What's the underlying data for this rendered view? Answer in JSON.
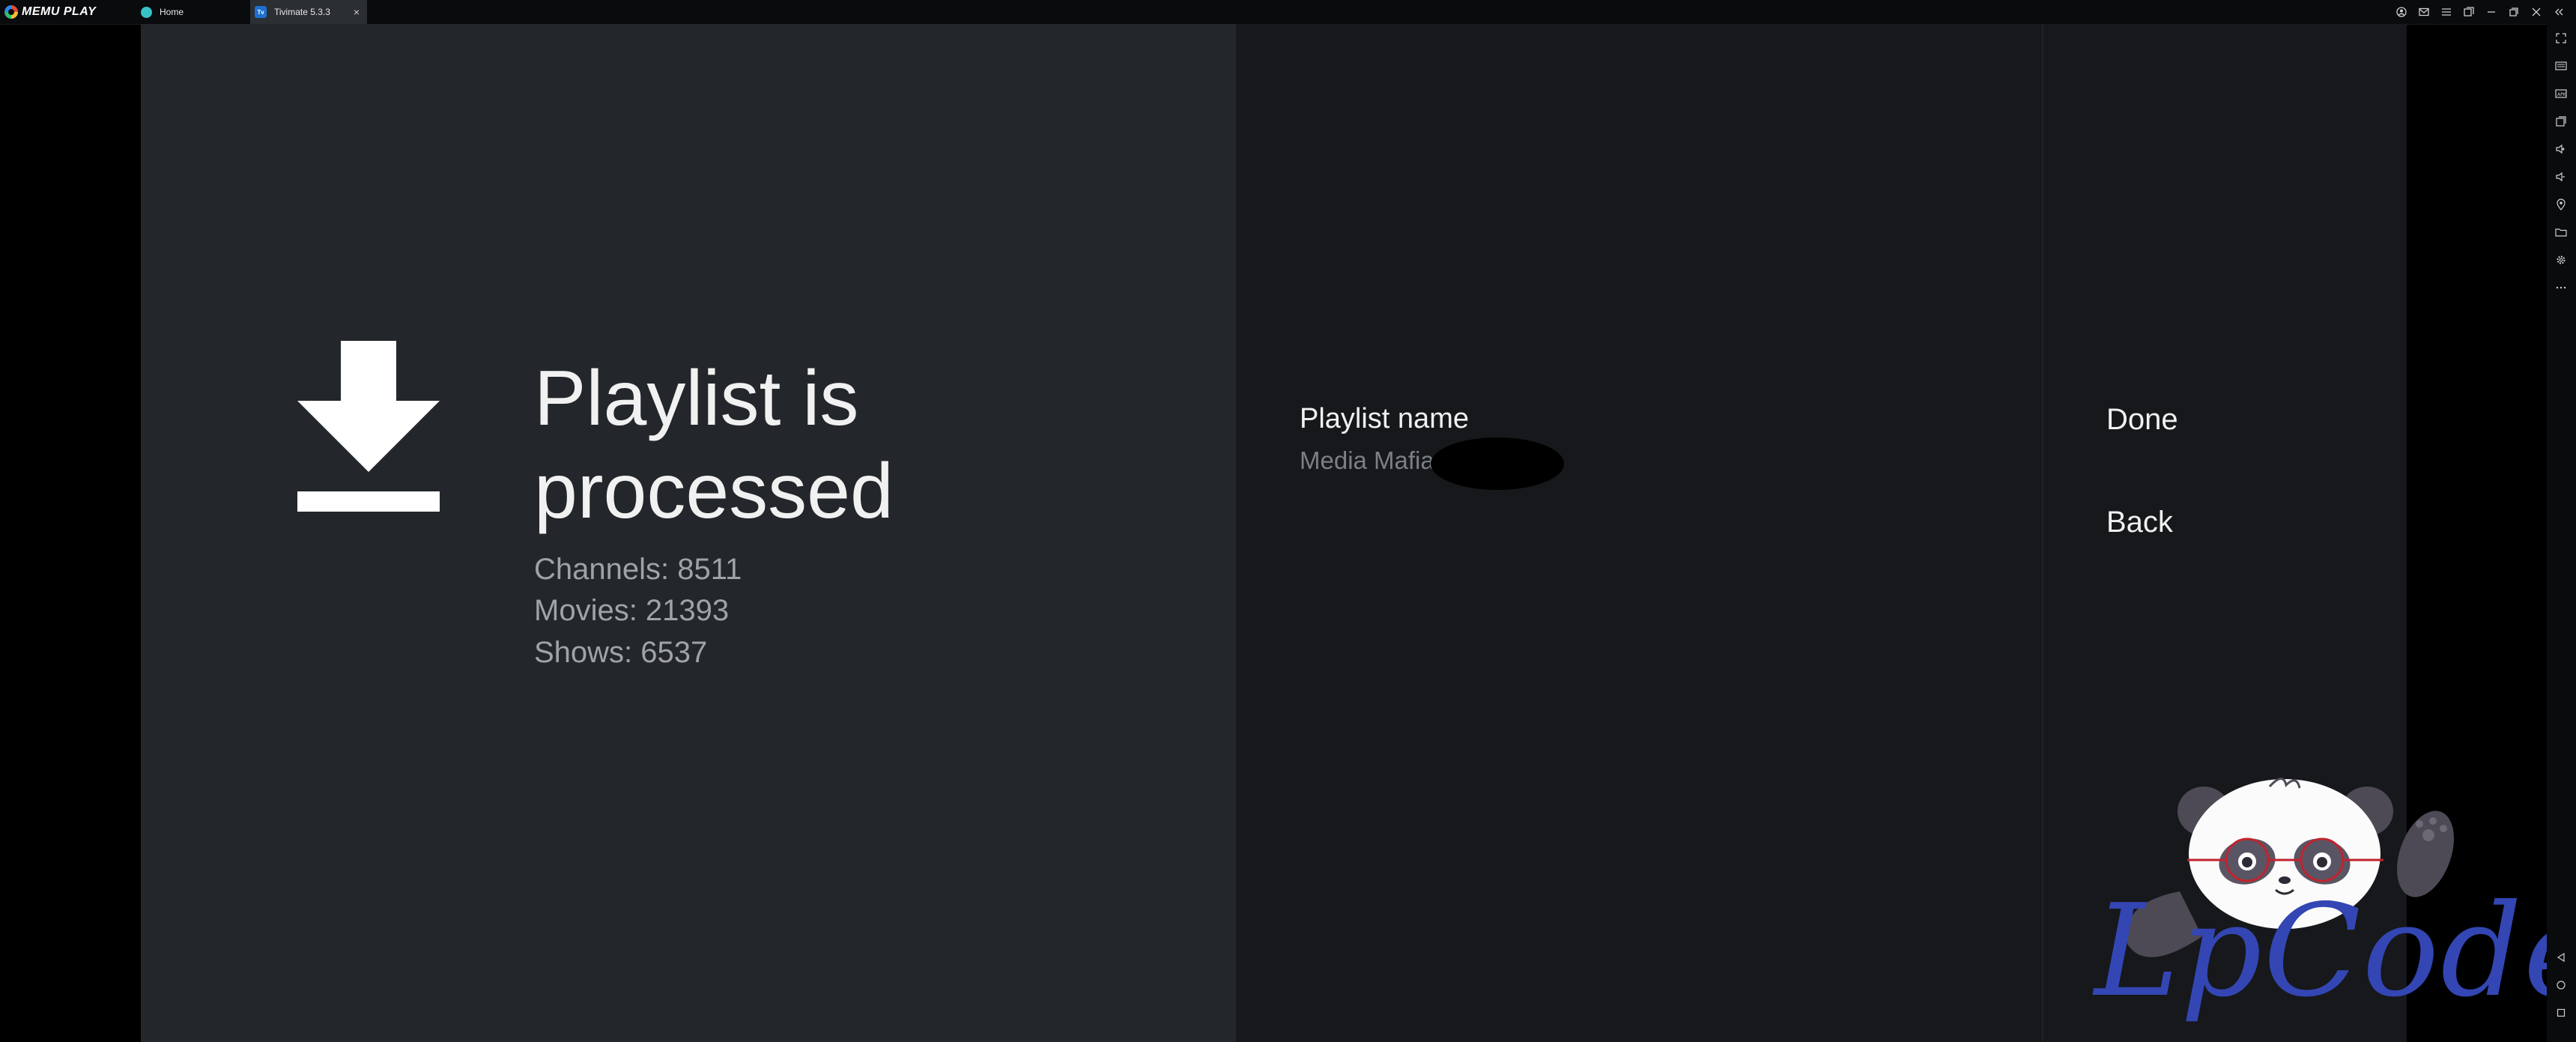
{
  "titlebar": {
    "app_name": "MEMU PLAY",
    "tabs": [
      {
        "label": "Home",
        "icon": "home-app-icon"
      },
      {
        "label": "Tivimate 5.3.3",
        "icon": "tivimate-app-icon",
        "close": "×"
      }
    ],
    "tivimate_icon_text": "Tv"
  },
  "status": {
    "title": "Playlist is processed",
    "title_line1": "Playlist is",
    "title_line2": "processed",
    "channels": "Channels: 8511",
    "movies": "Movies: 21393",
    "shows": "Shows: 6537"
  },
  "playlist": {
    "label": "Playlist name",
    "value": "Media Mafia -"
  },
  "actions": {
    "done": "Done",
    "back": "Back"
  },
  "watermark": {
    "text": "LpCodes"
  },
  "colors": {
    "left_panel": "#23262a",
    "right_panels": "#16181b",
    "watermark": "#3346b4"
  }
}
